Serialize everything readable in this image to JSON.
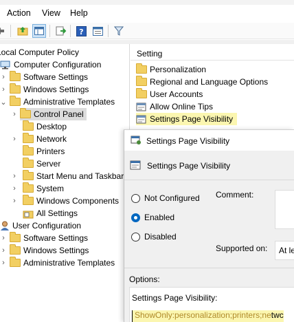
{
  "menu": {
    "action": "Action",
    "view": "View",
    "help": "Help"
  },
  "toolbar": {
    "icons": [
      "back-arrow-icon",
      "up-folder-icon",
      "show-hide-tree-icon",
      "export-list-icon",
      "help-icon",
      "properties-icon",
      "filter-icon"
    ]
  },
  "tree": {
    "root": "Local Computer Policy",
    "computer_config": "Computer Configuration",
    "cc_software": "Software Settings",
    "cc_windows": "Windows Settings",
    "cc_admin": "Administrative Templates",
    "control_panel": "Control Panel",
    "desktop": "Desktop",
    "network": "Network",
    "printers": "Printers",
    "server": "Server",
    "start_menu": "Start Menu and Taskbar",
    "system": "System",
    "windows_components": "Windows Components",
    "all_settings": "All Settings",
    "user_config": "User Configuration",
    "uc_software": "Software Settings",
    "uc_windows": "Windows Settings",
    "uc_admin": "Administrative Templates"
  },
  "right": {
    "header": "Setting",
    "items": [
      "Personalization",
      "Regional and Language Options",
      "User Accounts",
      "Allow Online Tips",
      "Settings Page Visibility"
    ]
  },
  "dialog": {
    "title": "Settings Page Visibility",
    "subtitle": "Settings Page Visibility",
    "not_configured": "Not Configured",
    "enabled": "Enabled",
    "disabled": "Disabled",
    "selected_option": "Enabled",
    "comment_label": "Comment:",
    "supported_label": "Supported on:",
    "supported_value": "At le",
    "options_label": "Options:",
    "option_field_label": "Settings Page Visibility:",
    "option_value_highlight": "ShowOnly:personalization;printers;ne",
    "option_value_rest": "twc"
  }
}
